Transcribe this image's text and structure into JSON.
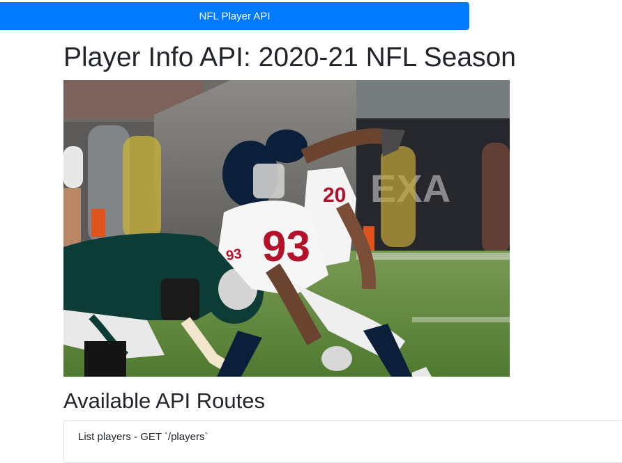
{
  "navbar": {
    "title": "NFL Player API",
    "color": "#007bff"
  },
  "page": {
    "title": "Player Info API: 2020-21 NFL Season"
  },
  "hero_image": {
    "home_number": "93",
    "home_number_2": "20",
    "colors": {
      "texans_navy": "#0b1f3a",
      "texans_red": "#b3122a",
      "eagles_green": "#0d3b35",
      "grass": "#4f7a2f"
    }
  },
  "routes": {
    "heading": "Available API Routes",
    "items": [
      {
        "label": "List players - GET `/players`"
      }
    ]
  }
}
